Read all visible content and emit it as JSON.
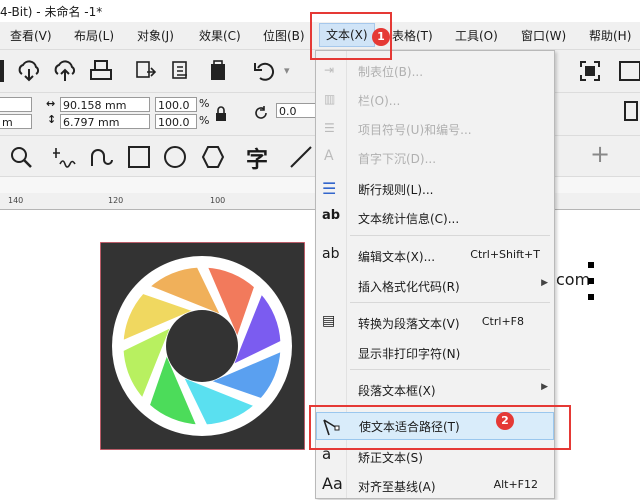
{
  "window": {
    "title": "4-Bit) - 未命名 -1*"
  },
  "menubar": {
    "items": [
      "查看(V)",
      "布局(L)",
      "对象(J)",
      "效果(C)",
      "位图(B)",
      "文本(X)",
      "表格(T)",
      "工具(O)",
      "窗口(W)",
      "帮助(H)"
    ],
    "active_index": 5
  },
  "propertybar": {
    "width": "90.158 mm",
    "height": "6.797 mm",
    "scale_x": "100.0",
    "scale_y": "100.0",
    "percent": "%",
    "rotation": "0.0",
    "left_unit_top": "m",
    "left_unit_bottom": "m"
  },
  "toolbox": {
    "text_tool_glyph": "字"
  },
  "ruler": {
    "ticks": [
      "140",
      "120",
      "100"
    ]
  },
  "canvas": {
    "partial_text": "com"
  },
  "dropdown": {
    "items": [
      {
        "label": "制表位(B)...",
        "disabled": true,
        "shortcut": "",
        "submenu": false,
        "icon": "tab-stop-icon"
      },
      {
        "label": "栏(O)...",
        "disabled": true,
        "shortcut": "",
        "submenu": false,
        "icon": "columns-icon"
      },
      {
        "label": "项目符号(U)和编号...",
        "disabled": true,
        "shortcut": "",
        "submenu": false,
        "icon": "bullets-icon"
      },
      {
        "label": "首字下沉(D)...",
        "disabled": true,
        "shortcut": "",
        "submenu": false,
        "icon": "drop-cap-icon"
      },
      {
        "label": "断行规则(L)...",
        "disabled": false,
        "shortcut": "",
        "submenu": false,
        "icon": "line-break-rules-icon"
      },
      {
        "label": "文本统计信息(C)...",
        "disabled": false,
        "shortcut": "",
        "submenu": false,
        "icon": "text-statistics-icon"
      },
      {
        "label": "编辑文本(X)...",
        "disabled": false,
        "shortcut": "Ctrl+Shift+T",
        "submenu": false,
        "icon": "edit-text-icon"
      },
      {
        "label": "插入格式化代码(R)",
        "disabled": false,
        "shortcut": "",
        "submenu": true,
        "icon": "formatting-code-icon"
      },
      {
        "label": "转换为段落文本(V)",
        "disabled": false,
        "shortcut": "Ctrl+F8",
        "submenu": false,
        "icon": "convert-paragraph-icon"
      },
      {
        "label": "显示非打印字符(N)",
        "disabled": false,
        "shortcut": "",
        "submenu": false,
        "icon": "non-printing-chars-icon"
      },
      {
        "label": "段落文本框(X)",
        "disabled": false,
        "shortcut": "",
        "submenu": true,
        "icon": "paragraph-frame-icon"
      },
      {
        "label": "使文本适合路径(T)",
        "disabled": false,
        "shortcut": "",
        "submenu": false,
        "icon": "fit-text-to-path-icon"
      },
      {
        "label": "矫正文本(S)",
        "disabled": false,
        "shortcut": "",
        "submenu": false,
        "icon": "straighten-text-icon"
      },
      {
        "label": "对齐至基线(A)",
        "disabled": false,
        "shortcut": "Alt+F12",
        "submenu": false,
        "icon": "align-baseline-icon"
      }
    ]
  },
  "annotations": {
    "badge1": "1",
    "badge2": "2",
    "color": "#e53935"
  },
  "logo": {
    "background": "#333333",
    "ring": "#ffffff",
    "colors": [
      "#f27a5c",
      "#7b5cf0",
      "#5aa0f0",
      "#5ae0f0",
      "#4cdc5a",
      "#b8f060",
      "#f0d860",
      "#f0b05a"
    ]
  }
}
